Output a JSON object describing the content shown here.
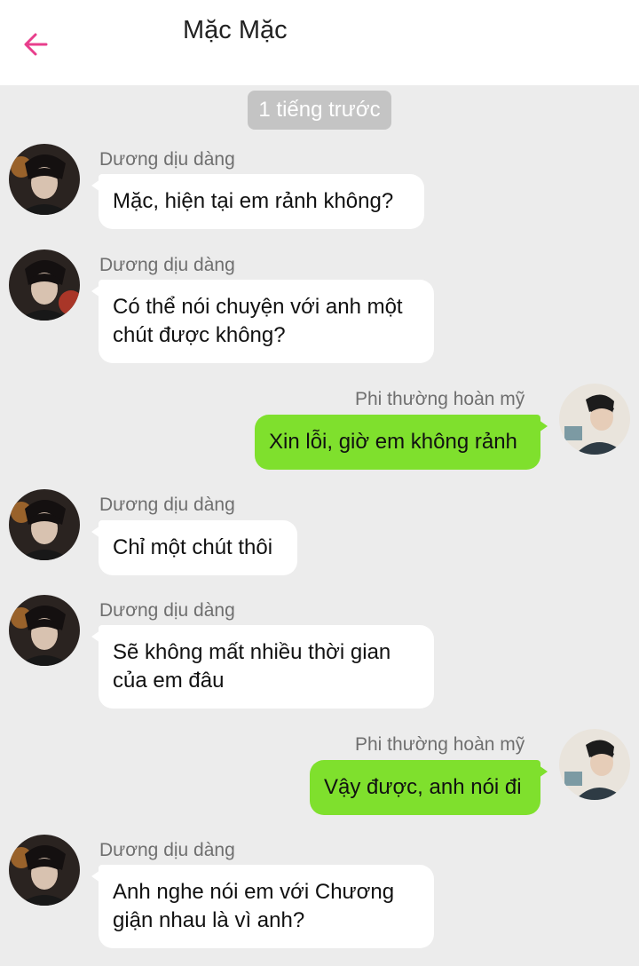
{
  "header": {
    "title": "Mặc Mặc",
    "back_icon": "arrow-left-icon",
    "accent_color": "#e83e8c"
  },
  "timestamp": "1 tiếng trước",
  "messages": [
    {
      "direction": "incoming",
      "sender": "Dương dịu dàng",
      "text": "Mặc, hiện tại em rảnh không?"
    },
    {
      "direction": "incoming",
      "sender": "Dương dịu dàng",
      "text": "Có thể nói chuyện với anh một\nchút được không?"
    },
    {
      "direction": "outgoing",
      "sender": "Phi thường hoàn mỹ",
      "text": "Xin lỗi, giờ em không rảnh"
    },
    {
      "direction": "incoming",
      "sender": "Dương dịu dàng",
      "text": "Chỉ một chút thôi"
    },
    {
      "direction": "incoming",
      "sender": "Dương dịu dàng",
      "text": "Sẽ không mất nhiều thời gian\ncủa em đâu"
    },
    {
      "direction": "outgoing",
      "sender": "Phi thường hoàn mỹ",
      "text": "Vậy được, anh nói đi"
    },
    {
      "direction": "incoming",
      "sender": "Dương dịu dàng",
      "text": "Anh nghe nói em với Chương\ngiận nhau là vì anh?"
    }
  ],
  "colors": {
    "outgoing_bubble": "#7fe02d",
    "incoming_bubble": "#ffffff",
    "background": "#ececec"
  }
}
